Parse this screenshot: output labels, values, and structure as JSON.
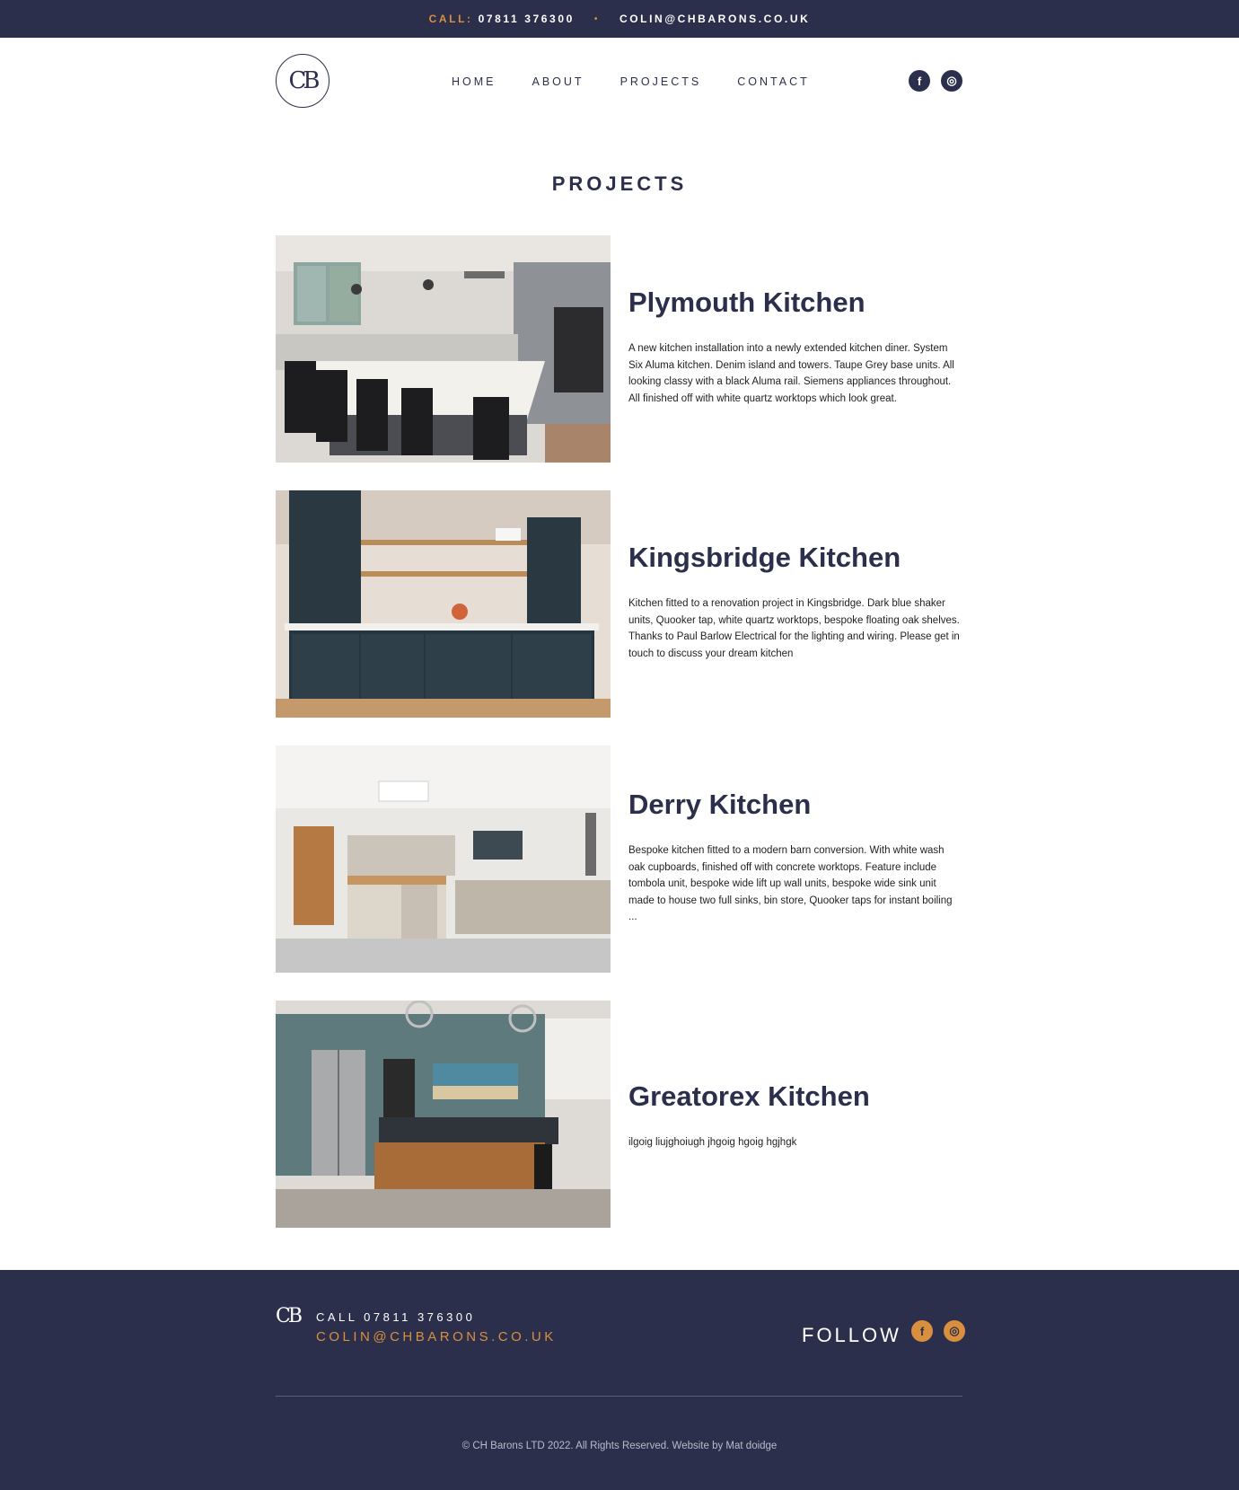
{
  "topbar": {
    "call_label": "CALL:",
    "phone": "07811 376300",
    "separator": "•",
    "email": "COLIN@CHBARONS.CO.UK"
  },
  "header": {
    "logo": "CB",
    "nav": [
      {
        "label": "HOME"
      },
      {
        "label": "ABOUT"
      },
      {
        "label": "PROJECTS"
      },
      {
        "label": "CONTACT"
      }
    ],
    "social": [
      {
        "icon": "facebook-icon",
        "glyph": "f"
      },
      {
        "icon": "instagram-icon",
        "glyph": "◎"
      }
    ]
  },
  "page_title": "PROJECTS",
  "projects": [
    {
      "title": "Plymouth Kitchen",
      "description": "A new kitchen installation into a newly extended kitchen diner. System Six Aluma kitchen. Denim island and towers. Taupe Grey base units. All looking classy with a black Aluma rail. Siemens appliances throughout. All finished off with white quartz worktops which look great."
    },
    {
      "title": "Kingsbridge Kitchen",
      "description": "Kitchen fitted to a renovation project in Kingsbridge. Dark blue shaker units, Quooker tap, white quartz worktops, bespoke floating oak shelves. Thanks to Paul Barlow Electrical for the lighting and wiring. Please get in touch to discuss your dream kitchen"
    },
    {
      "title": "Derry Kitchen",
      "description": "Bespoke kitchen fitted to a modern barn conversion. With white wash oak cupboards, finished off with concrete worktops. Feature include tombola unit, bespoke wide lift up wall units, bespoke wide sink unit made to house two full sinks, bin store, Quooker taps for instant boiling ..."
    },
    {
      "title": "Greatorex Kitchen",
      "description": "ilgoig liujghoiugh jhgoig hgoig hgjhgk"
    }
  ],
  "footer": {
    "logo": "CB",
    "call": "CALL 07811 376300",
    "email": "COLIN@CHBARONS.CO.UK",
    "follow": "FOLLOW",
    "social": [
      {
        "icon": "facebook-icon",
        "glyph": "f"
      },
      {
        "icon": "instagram-icon",
        "glyph": "◎"
      }
    ],
    "copyright": "© CH Barons LTD 2022. All Rights Reserved. Website by Mat doidge"
  },
  "colors": {
    "navy": "#2b2f4b",
    "accent": "#d98f3e"
  }
}
